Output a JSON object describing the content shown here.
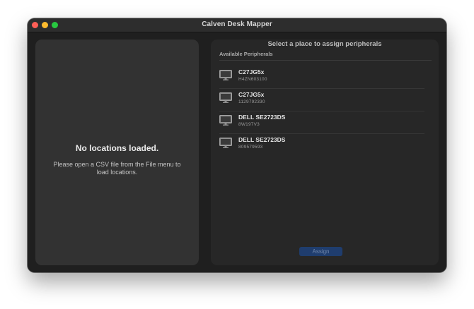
{
  "window": {
    "title": "Calven Desk Mapper"
  },
  "locations": {
    "empty_title": "No locations loaded.",
    "empty_message": "Please open a CSV file from the File menu to load locations."
  },
  "peripherals": {
    "header": "Select a place to assign peripherals",
    "section_label": "Available Peripherals",
    "items": [
      {
        "name": "C27JG5x",
        "serial": "H4ZN603100",
        "icon": "monitor-icon"
      },
      {
        "name": "C27JG5x",
        "serial": "1129792330",
        "icon": "monitor-icon"
      },
      {
        "name": "DELL SE2723DS",
        "serial": "8W197V3",
        "icon": "monitor-icon"
      },
      {
        "name": "DELL SE2723DS",
        "serial": "809579593",
        "icon": "monitor-icon"
      }
    ],
    "assign_label": "Assign",
    "assign_enabled": false
  },
  "colors": {
    "close": "#ff5f57",
    "minimize": "#febc2e",
    "zoom": "#28c840",
    "accent_disabled": "#1f3d6e"
  }
}
